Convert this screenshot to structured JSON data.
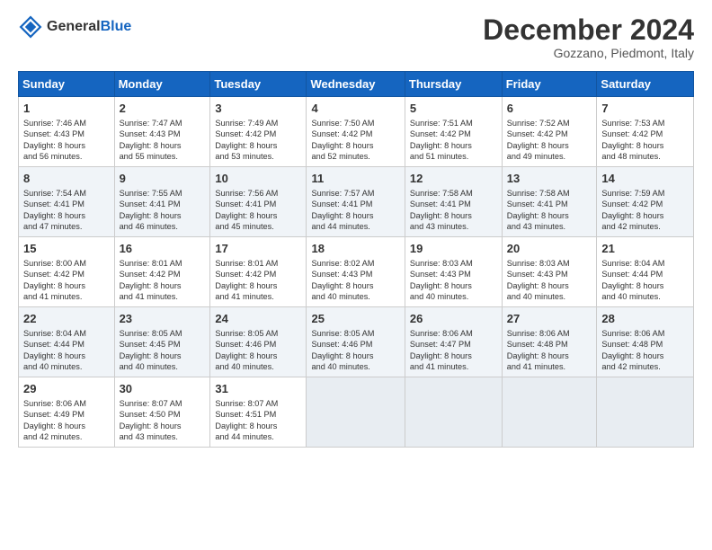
{
  "header": {
    "logo_line1": "General",
    "logo_line2": "Blue",
    "month": "December 2024",
    "location": "Gozzano, Piedmont, Italy"
  },
  "days_of_week": [
    "Sunday",
    "Monday",
    "Tuesday",
    "Wednesday",
    "Thursday",
    "Friday",
    "Saturday"
  ],
  "weeks": [
    [
      {
        "day": "1",
        "info": "Sunrise: 7:46 AM\nSunset: 4:43 PM\nDaylight: 8 hours\nand 56 minutes."
      },
      {
        "day": "2",
        "info": "Sunrise: 7:47 AM\nSunset: 4:43 PM\nDaylight: 8 hours\nand 55 minutes."
      },
      {
        "day": "3",
        "info": "Sunrise: 7:49 AM\nSunset: 4:42 PM\nDaylight: 8 hours\nand 53 minutes."
      },
      {
        "day": "4",
        "info": "Sunrise: 7:50 AM\nSunset: 4:42 PM\nDaylight: 8 hours\nand 52 minutes."
      },
      {
        "day": "5",
        "info": "Sunrise: 7:51 AM\nSunset: 4:42 PM\nDaylight: 8 hours\nand 51 minutes."
      },
      {
        "day": "6",
        "info": "Sunrise: 7:52 AM\nSunset: 4:42 PM\nDaylight: 8 hours\nand 49 minutes."
      },
      {
        "day": "7",
        "info": "Sunrise: 7:53 AM\nSunset: 4:42 PM\nDaylight: 8 hours\nand 48 minutes."
      }
    ],
    [
      {
        "day": "8",
        "info": "Sunrise: 7:54 AM\nSunset: 4:41 PM\nDaylight: 8 hours\nand 47 minutes."
      },
      {
        "day": "9",
        "info": "Sunrise: 7:55 AM\nSunset: 4:41 PM\nDaylight: 8 hours\nand 46 minutes."
      },
      {
        "day": "10",
        "info": "Sunrise: 7:56 AM\nSunset: 4:41 PM\nDaylight: 8 hours\nand 45 minutes."
      },
      {
        "day": "11",
        "info": "Sunrise: 7:57 AM\nSunset: 4:41 PM\nDaylight: 8 hours\nand 44 minutes."
      },
      {
        "day": "12",
        "info": "Sunrise: 7:58 AM\nSunset: 4:41 PM\nDaylight: 8 hours\nand 43 minutes."
      },
      {
        "day": "13",
        "info": "Sunrise: 7:58 AM\nSunset: 4:41 PM\nDaylight: 8 hours\nand 43 minutes."
      },
      {
        "day": "14",
        "info": "Sunrise: 7:59 AM\nSunset: 4:42 PM\nDaylight: 8 hours\nand 42 minutes."
      }
    ],
    [
      {
        "day": "15",
        "info": "Sunrise: 8:00 AM\nSunset: 4:42 PM\nDaylight: 8 hours\nand 41 minutes."
      },
      {
        "day": "16",
        "info": "Sunrise: 8:01 AM\nSunset: 4:42 PM\nDaylight: 8 hours\nand 41 minutes."
      },
      {
        "day": "17",
        "info": "Sunrise: 8:01 AM\nSunset: 4:42 PM\nDaylight: 8 hours\nand 41 minutes."
      },
      {
        "day": "18",
        "info": "Sunrise: 8:02 AM\nSunset: 4:43 PM\nDaylight: 8 hours\nand 40 minutes."
      },
      {
        "day": "19",
        "info": "Sunrise: 8:03 AM\nSunset: 4:43 PM\nDaylight: 8 hours\nand 40 minutes."
      },
      {
        "day": "20",
        "info": "Sunrise: 8:03 AM\nSunset: 4:43 PM\nDaylight: 8 hours\nand 40 minutes."
      },
      {
        "day": "21",
        "info": "Sunrise: 8:04 AM\nSunset: 4:44 PM\nDaylight: 8 hours\nand 40 minutes."
      }
    ],
    [
      {
        "day": "22",
        "info": "Sunrise: 8:04 AM\nSunset: 4:44 PM\nDaylight: 8 hours\nand 40 minutes."
      },
      {
        "day": "23",
        "info": "Sunrise: 8:05 AM\nSunset: 4:45 PM\nDaylight: 8 hours\nand 40 minutes."
      },
      {
        "day": "24",
        "info": "Sunrise: 8:05 AM\nSunset: 4:46 PM\nDaylight: 8 hours\nand 40 minutes."
      },
      {
        "day": "25",
        "info": "Sunrise: 8:05 AM\nSunset: 4:46 PM\nDaylight: 8 hours\nand 40 minutes."
      },
      {
        "day": "26",
        "info": "Sunrise: 8:06 AM\nSunset: 4:47 PM\nDaylight: 8 hours\nand 41 minutes."
      },
      {
        "day": "27",
        "info": "Sunrise: 8:06 AM\nSunset: 4:48 PM\nDaylight: 8 hours\nand 41 minutes."
      },
      {
        "day": "28",
        "info": "Sunrise: 8:06 AM\nSunset: 4:48 PM\nDaylight: 8 hours\nand 42 minutes."
      }
    ],
    [
      {
        "day": "29",
        "info": "Sunrise: 8:06 AM\nSunset: 4:49 PM\nDaylight: 8 hours\nand 42 minutes."
      },
      {
        "day": "30",
        "info": "Sunrise: 8:07 AM\nSunset: 4:50 PM\nDaylight: 8 hours\nand 43 minutes."
      },
      {
        "day": "31",
        "info": "Sunrise: 8:07 AM\nSunset: 4:51 PM\nDaylight: 8 hours\nand 44 minutes."
      },
      {
        "day": "",
        "info": ""
      },
      {
        "day": "",
        "info": ""
      },
      {
        "day": "",
        "info": ""
      },
      {
        "day": "",
        "info": ""
      }
    ]
  ]
}
